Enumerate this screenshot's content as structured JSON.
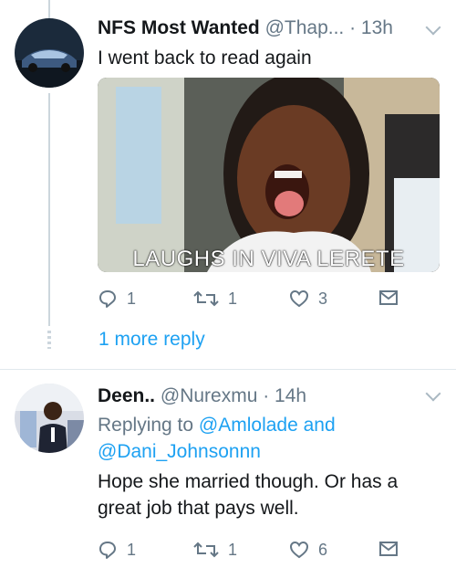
{
  "tweet1": {
    "display_name": "NFS Most Wanted",
    "handle": "@Thap...",
    "time": "· 13h",
    "text": "I went back to read again",
    "media_caption": "LAUGHS IN VIVA LERETE",
    "replies": "1",
    "retweets": "1",
    "likes": "3"
  },
  "more_replies": "1 more reply",
  "tweet2": {
    "display_name": "Deen..",
    "handle": "@Nurexmu",
    "time": "· 14h",
    "replying_prefix": "Replying to",
    "replying_user1": "@Amlolade",
    "replying_and": "and",
    "replying_user2": "@Dani_Johnsonnn",
    "text_line1": "Hope she married though. Or has a",
    "text_line2": "great job that pays well.",
    "replies": "1",
    "retweets": "1",
    "likes": "6"
  },
  "colors": {
    "accent": "#1da1f2",
    "muted": "#657786",
    "divider": "#e1e8ed"
  }
}
